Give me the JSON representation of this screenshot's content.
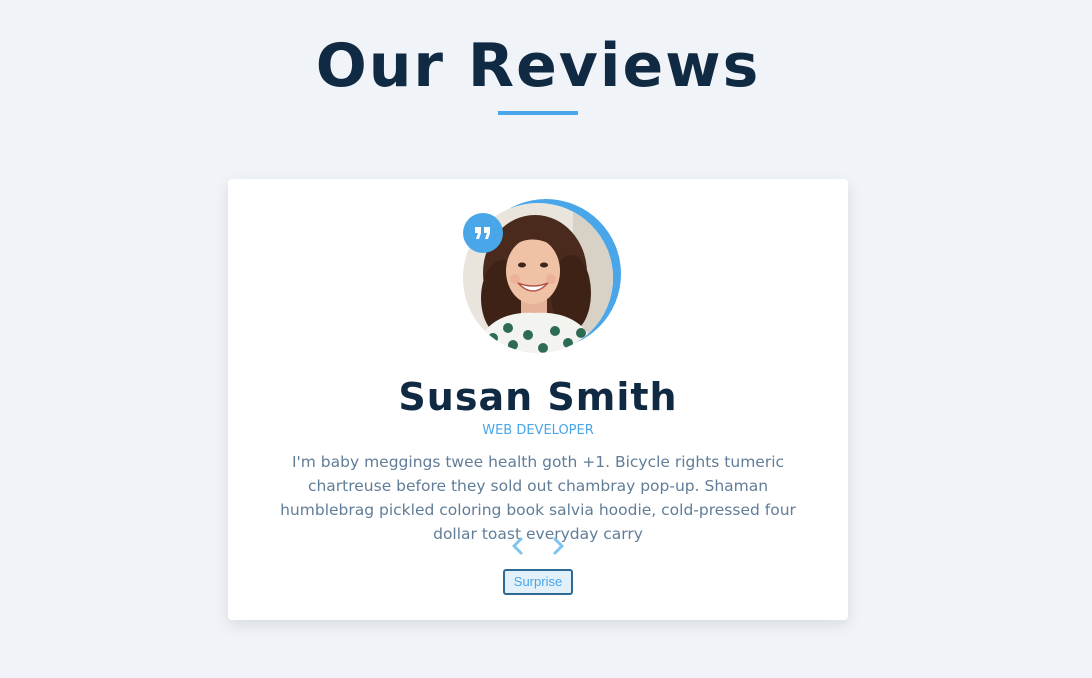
{
  "page": {
    "title": "Our Reviews"
  },
  "review": {
    "name": "Susan Smith",
    "job": "WEB DEVELOPER",
    "text": "I'm baby meggings twee health goth +1. Bicycle rights tumeric chartreuse before they sold out chambray pop-up. Shaman humblebrag pickled coloring book salvia hoodie, cold-pressed four dollar toast everyday carry"
  },
  "buttons": {
    "prev_icon": "chevron-left-icon",
    "next_icon": "chevron-right-icon",
    "random_label": "Surprise"
  },
  "icons": {
    "quote": "quote-icon"
  },
  "colors": {
    "background": "#f0f4f8",
    "accent": "#49a6e9",
    "heading": "#102a43",
    "body_text": "#617d98",
    "card": "#ffffff"
  }
}
